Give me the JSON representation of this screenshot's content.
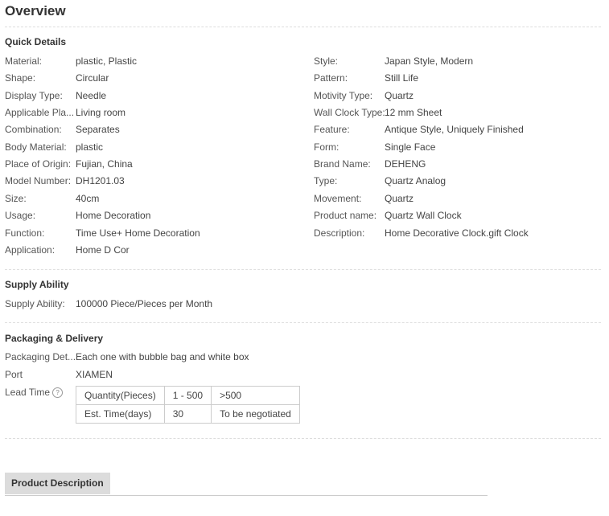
{
  "overview": {
    "title": "Overview"
  },
  "quick_details": {
    "title": "Quick Details",
    "left": [
      {
        "label": "Material:",
        "value": "plastic, Plastic"
      },
      {
        "label": "Shape:",
        "value": "Circular"
      },
      {
        "label": "Display Type:",
        "value": "Needle"
      },
      {
        "label": "Applicable Pla...",
        "value": "Living room"
      },
      {
        "label": "Combination:",
        "value": "Separates"
      },
      {
        "label": "Body Material:",
        "value": "plastic"
      },
      {
        "label": "Place of Origin:",
        "value": "Fujian, China"
      },
      {
        "label": "Model Number:",
        "value": "DH1201.03"
      },
      {
        "label": "Size:",
        "value": "40cm"
      },
      {
        "label": "Usage:",
        "value": "Home Decoration"
      },
      {
        "label": "Function:",
        "value": "Time Use+ Home Decoration"
      },
      {
        "label": "Application:",
        "value": "Home D Cor"
      }
    ],
    "right": [
      {
        "label": "Style:",
        "value": "Japan Style, Modern"
      },
      {
        "label": "Pattern:",
        "value": "Still Life"
      },
      {
        "label": "Motivity Type:",
        "value": "Quartz"
      },
      {
        "label": "Wall Clock Type:",
        "value": "12 mm Sheet"
      },
      {
        "label": "Feature:",
        "value": "Antique Style, Uniquely Finished"
      },
      {
        "label": "Form:",
        "value": "Single Face"
      },
      {
        "label": "Brand Name:",
        "value": "DEHENG"
      },
      {
        "label": "Type:",
        "value": "Quartz Analog"
      },
      {
        "label": "Movement:",
        "value": "Quartz"
      },
      {
        "label": "Product name:",
        "value": "Quartz Wall Clock"
      },
      {
        "label": "Description:",
        "value": "Home Decorative Clock.gift Clock"
      }
    ]
  },
  "supply": {
    "title": "Supply Ability",
    "label": "Supply Ability:",
    "value": "100000 Piece/Pieces per Month"
  },
  "packaging": {
    "title": "Packaging & Delivery",
    "details_label": "Packaging Det...",
    "details_value": "Each one with bubble bag and white box",
    "port_label": "Port",
    "port_value": "XIAMEN",
    "lead_time_label": "Lead Time",
    "help_glyph": "?",
    "lead_table": [
      [
        "Quantity(Pieces)",
        "1 - 500",
        ">500"
      ],
      [
        "Est. Time(days)",
        "30",
        "To be negotiated"
      ]
    ]
  },
  "product_description_tab": {
    "label": "Product Description"
  }
}
